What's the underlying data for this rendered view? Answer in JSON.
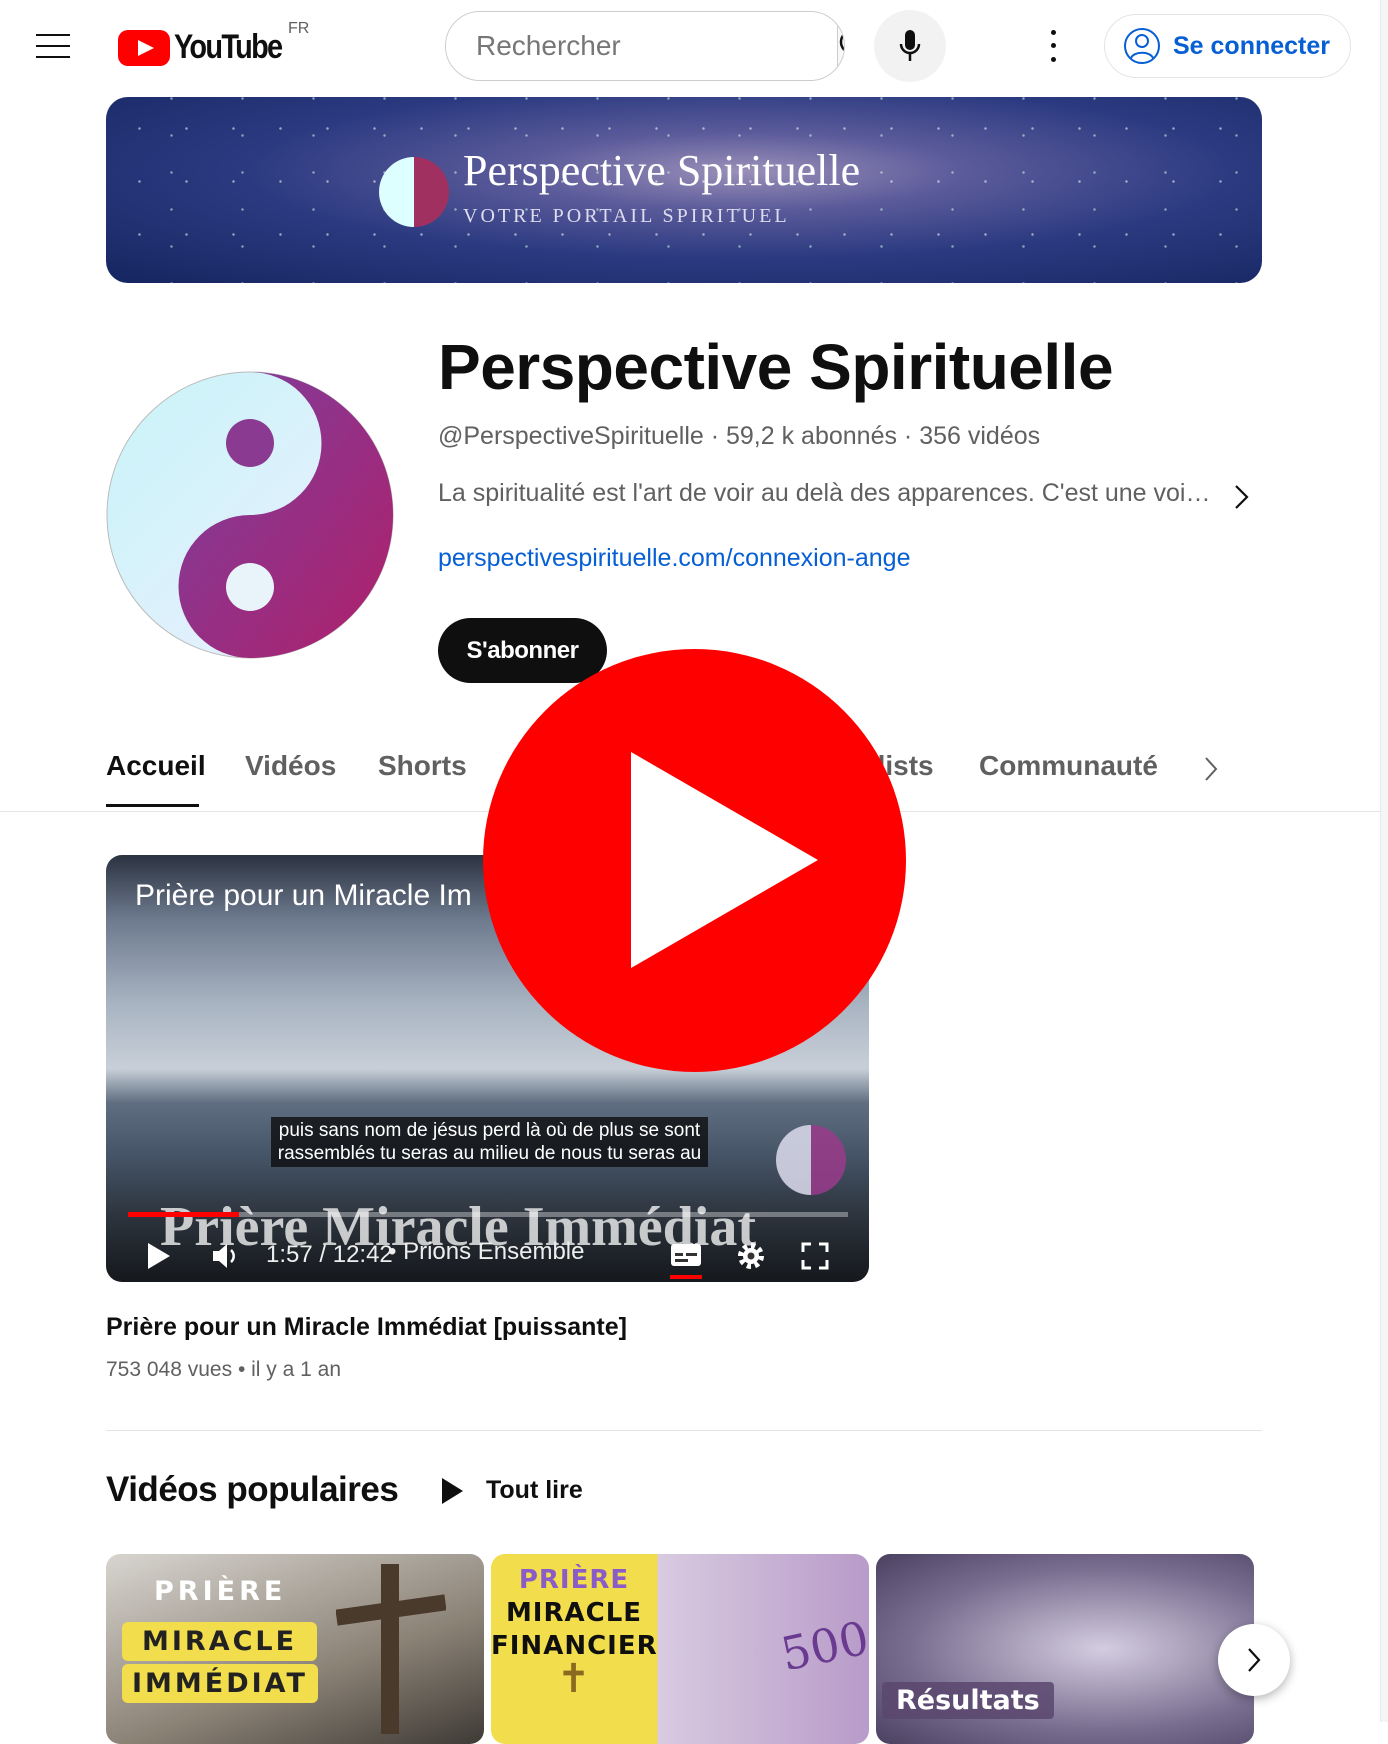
{
  "header": {
    "logo_text": "YouTube",
    "country": "FR",
    "search_placeholder": "Rechercher",
    "signin_label": "Se connecter"
  },
  "banner": {
    "title": "Perspective Spirituelle",
    "subtitle": "VOTRE PORTAIL SPIRITUEL"
  },
  "channel": {
    "name": "Perspective Spirituelle",
    "handle": "@PerspectiveSpirituelle",
    "subscribers": "59,2 k abonnés",
    "videos": "356 vidéos",
    "description": "La spiritualité est l'art de voir au delà des apparences. C'est une voi…",
    "link": "perspectivespirituelle.com/connexion-ange",
    "subscribe_label": "S'abonner"
  },
  "tabs": [
    {
      "label": "Accueil",
      "active": true
    },
    {
      "label": "Vidéos"
    },
    {
      "label": "Shorts"
    },
    {
      "label": "Playlists"
    },
    {
      "label": "Communauté"
    }
  ],
  "featured": {
    "overlay_title": "Prière pour un Miracle Im",
    "caption_line1": "puis sans nom de jésus perd là où de plus se sont",
    "caption_line2": "rassemblés tu seras au milieu de nous tu seras au",
    "watermark": "Prière Miracle Immédiat",
    "time": "1:57 / 12:42",
    "chapter": "• Prions Ensemble",
    "progress_percent": 15.4,
    "title": "Prière pour un Miracle Immédiat [puissante]",
    "views": "753 048 vues",
    "age": "il y a 1 an"
  },
  "popular": {
    "heading": "Vidéos populaires",
    "play_all": "Tout lire",
    "thumbs": [
      {
        "line1": "PRIÈRE",
        "line2": "MIRACLE",
        "line3": "IMMÉDIAT"
      },
      {
        "line1": "PRIÈRE",
        "line2": "MIRACLE",
        "line3": "FINANCIER",
        "note": "500"
      },
      {
        "label": "Résultats"
      }
    ]
  },
  "colors": {
    "accent": "#ff0000",
    "link": "#065fd4",
    "text": "#0f0f0f",
    "secondary": "#606060"
  }
}
